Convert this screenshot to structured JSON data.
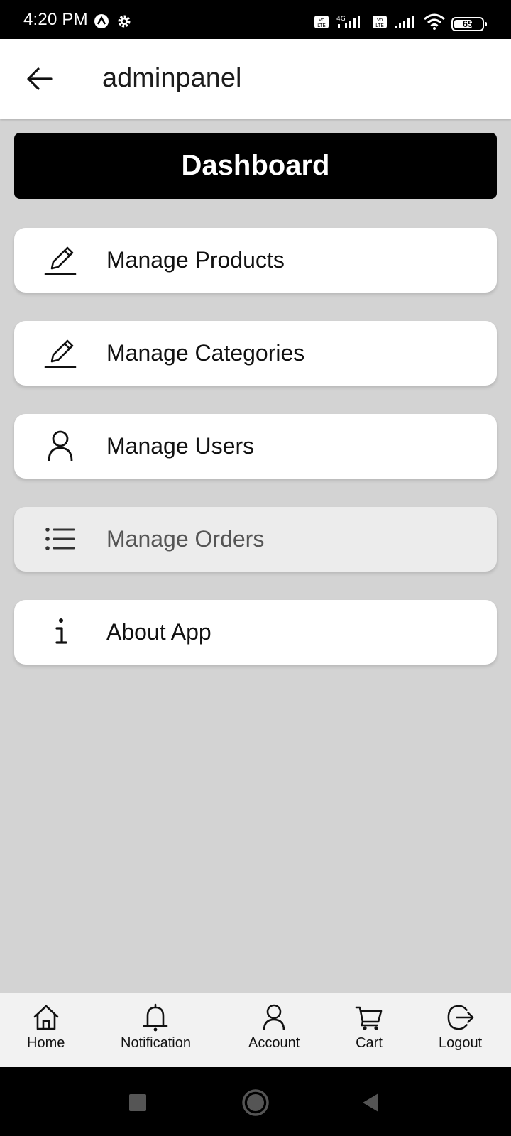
{
  "status_bar": {
    "time": "4:20 PM",
    "battery_level": 65,
    "battery_text": "65"
  },
  "header": {
    "title": "adminpanel",
    "back_icon": "arrow-left-icon"
  },
  "dashboard": {
    "title": "Dashboard"
  },
  "menu": {
    "items": [
      {
        "label": "Manage Products",
        "icon": "pencil-icon"
      },
      {
        "label": "Manage Categories",
        "icon": "pencil-icon"
      },
      {
        "label": "Manage Users",
        "icon": "user-icon"
      },
      {
        "label": "Manage Orders",
        "icon": "list-icon",
        "selected": true
      },
      {
        "label": "About App",
        "icon": "info-icon"
      }
    ]
  },
  "bottom_nav": {
    "items": [
      {
        "label": "Home",
        "icon": "home-icon"
      },
      {
        "label": "Notification",
        "icon": "bell-icon"
      },
      {
        "label": "Account",
        "icon": "user-icon"
      },
      {
        "label": "Cart",
        "icon": "cart-icon"
      },
      {
        "label": "Logout",
        "icon": "logout-icon"
      }
    ]
  },
  "colors": {
    "background": "#d3d3d3",
    "banner": "#000000",
    "card": "#ffffff",
    "card_selected": "#ececec"
  }
}
